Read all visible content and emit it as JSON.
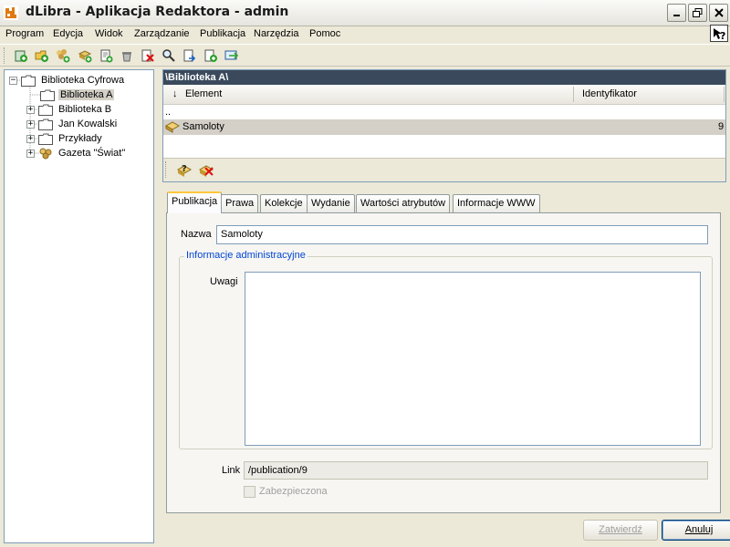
{
  "window": {
    "title": "dLibra - Aplikacja Redaktora - admin"
  },
  "menu": {
    "items": [
      "Program",
      "Edycja",
      "Widok",
      "Zarządzanie",
      "Publikacja",
      "Narzędzia",
      "Pomoc"
    ]
  },
  "toolbar": {
    "icons": [
      "add-library-icon",
      "add-folder-icon",
      "add-group-icon",
      "add-publication-icon",
      "add-edition-icon",
      "delete-icon",
      "remove-icon",
      "search-icon",
      "import-icon",
      "export-icon",
      "refresh-icon"
    ]
  },
  "tree": {
    "root": "Biblioteka Cyfrowa",
    "items": [
      {
        "label": "Biblioteka A",
        "selected": true
      },
      {
        "label": "Biblioteka B"
      },
      {
        "label": "Jan Kowalski"
      },
      {
        "label": "Przykłady"
      },
      {
        "label": "Gazeta \"Świat\""
      }
    ]
  },
  "browser": {
    "path": "\\Biblioteka A\\",
    "columns": {
      "sort_arrow": "↓",
      "element": "Element",
      "identifier": "Identyfikator"
    },
    "parent_row": "..",
    "rows": [
      {
        "name": "Samoloty",
        "id": "9"
      }
    ]
  },
  "tabs": [
    "Publikacja",
    "Prawa",
    "Kolekcje",
    "Wydanie",
    "Wartości atrybutów",
    "Informacje WWW"
  ],
  "form": {
    "name_label": "Nazwa",
    "name_value": "Samoloty",
    "admin_group": "Informacje administracyjne",
    "notes_label": "Uwagi",
    "notes_value": "",
    "link_label": "Link",
    "link_value": "/publication/9",
    "protected_label": "Zabezpieczona"
  },
  "buttons": {
    "confirm": "Zatwierdź",
    "cancel": "Anuluj"
  },
  "colors": {
    "path_bar": "#3a4a5c",
    "tab_accent": "#ffc83c",
    "group_title": "#0046d5"
  }
}
